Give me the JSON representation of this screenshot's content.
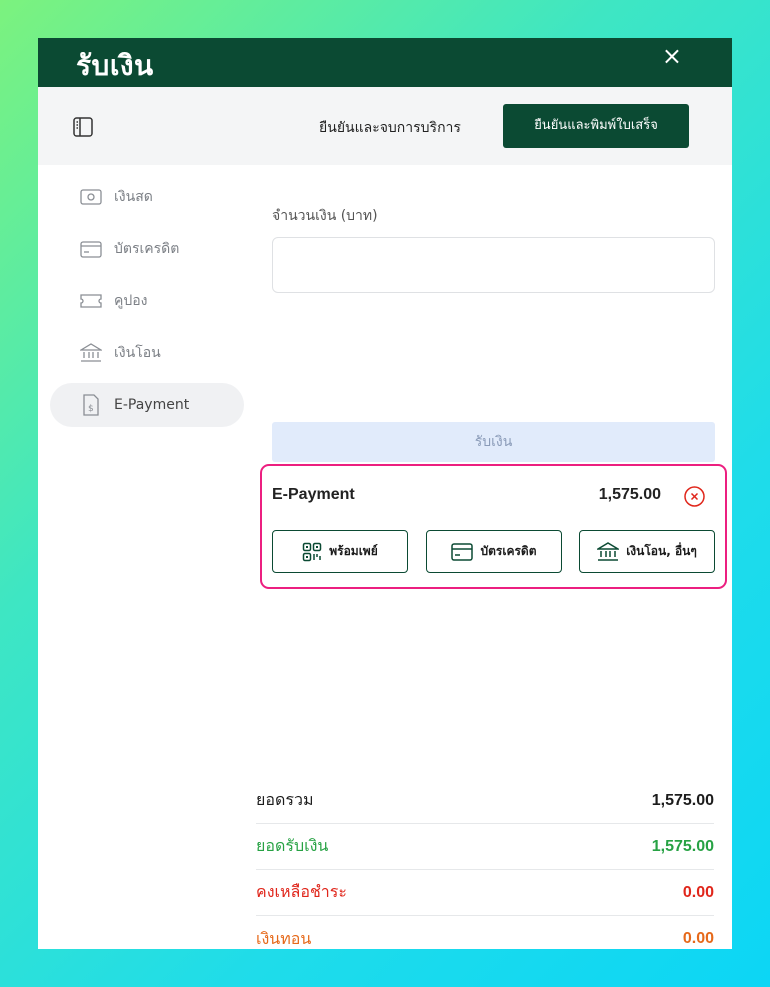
{
  "header": {
    "title": "รับเงิน",
    "close_icon": "×"
  },
  "toolbar": {
    "confirm_end_label": "ยืนยันและจบการบริการ",
    "confirm_print_label": "ยืนยันและพิมพ์ใบเสร็จ"
  },
  "sidebar": {
    "items": [
      {
        "label": "เงินสด",
        "icon": "cash-icon"
      },
      {
        "label": "บัตรเครดิต",
        "icon": "credit-card-icon"
      },
      {
        "label": "คูปอง",
        "icon": "coupon-icon"
      },
      {
        "label": "เงินโอน",
        "icon": "bank-icon"
      },
      {
        "label": "E-Payment",
        "icon": "receipt-dollar-icon",
        "active": true
      }
    ]
  },
  "main": {
    "amount_label": "จำนวนเงิน (บาท)",
    "amount_value": "",
    "receive_button_label": "รับเงิน"
  },
  "epayment": {
    "title": "E-Payment",
    "amount": "1,575.00",
    "methods": [
      {
        "label": "พร้อมเพย์",
        "icon": "qr-code-icon"
      },
      {
        "label": "บัตรเครดิต",
        "icon": "credit-card-icon"
      },
      {
        "label": "เงินโอน, อื่นๆ",
        "icon": "bank-icon"
      }
    ]
  },
  "summary": {
    "total_label": "ยอดรวม",
    "total_value": "1,575.00",
    "received_label": "ยอดรับเงิน",
    "received_value": "1,575.00",
    "remaining_label": "คงเหลือชำระ",
    "remaining_value": "0.00",
    "change_label": "เงินทอน",
    "change_value": "0.00"
  },
  "colors": {
    "brand": "#0b4a33",
    "highlight": "#ec1f80",
    "paid": "#27a244",
    "remaining": "#e0261b",
    "change": "#e6691a"
  }
}
